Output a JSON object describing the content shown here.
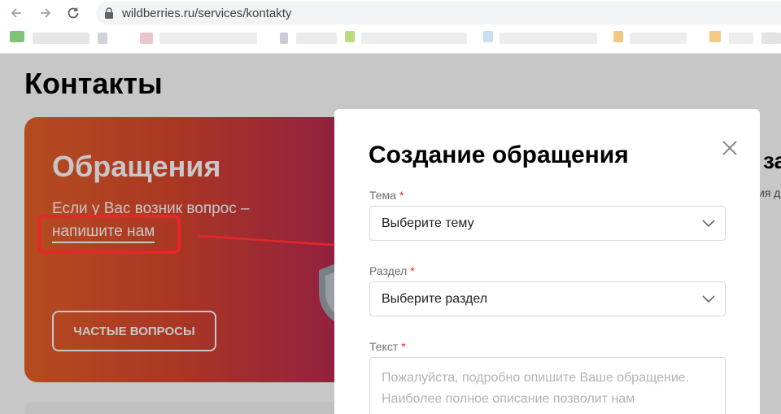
{
  "browser": {
    "url": "wildberries.ru/services/kontakty"
  },
  "page": {
    "title": "Контакты",
    "card": {
      "title": "Обращения",
      "text": "Если у Вас возник вопрос –",
      "link": "напишите нам",
      "faq_button": "ЧАСТЫЕ ВОПРОСЫ"
    },
    "side_title": "за",
    "side_text": "ия д"
  },
  "modal": {
    "title": "Создание обращения",
    "fields": {
      "topic_label": "Тема",
      "topic_placeholder": "Выберите тему",
      "section_label": "Раздел",
      "section_placeholder": "Выберите раздел",
      "text_label": "Текст",
      "text_placeholder_1": "Пожалуйста, подробно опишите Ваше обращение.",
      "text_placeholder_2": "Наиболее полное описание позволит нам"
    },
    "required_mark": "*"
  },
  "colors": {
    "accent_red": "#e8262a",
    "card_start": "#e8622a",
    "card_end": "#b4245a"
  }
}
